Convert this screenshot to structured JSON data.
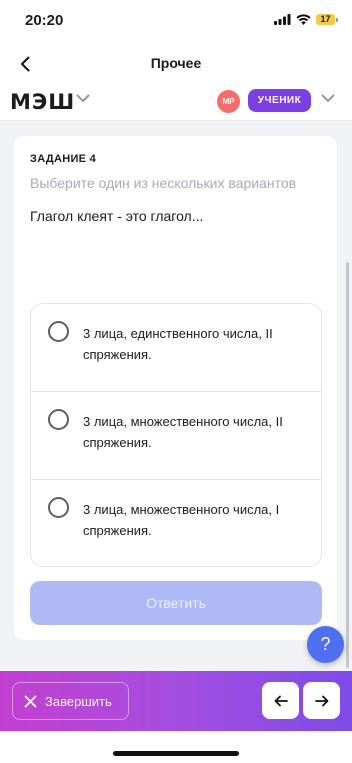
{
  "status_bar": {
    "time": "20:20",
    "battery_level": "17"
  },
  "nav": {
    "title": "Прочее"
  },
  "app_bar": {
    "logo": "МЭШ",
    "avatar_initials": "МР",
    "role": "УЧЕНИК"
  },
  "task": {
    "label": "ЗАДАНИЕ 4",
    "hint": "Выберите один из нескольких вариантов",
    "question": "Глагол клеят - это глагол...",
    "options": [
      {
        "text": "3 лица, единственного числа, II спряжения."
      },
      {
        "text": "3 лица, множественного числа, II спряжения."
      },
      {
        "text": "3 лица, множественного числа, I спряжения."
      }
    ],
    "submit_label": "Ответить"
  },
  "help": {
    "label": "?"
  },
  "bottom_bar": {
    "finish_label": "Завершить"
  },
  "colors": {
    "accent_purple": "#7b3fe4",
    "avatar_red": "#f46d6d",
    "submit_disabled": "#aeb9f6",
    "help_blue": "#4f6ff0",
    "gradient_start": "#c33fd1",
    "gradient_end": "#7d4ce8"
  }
}
